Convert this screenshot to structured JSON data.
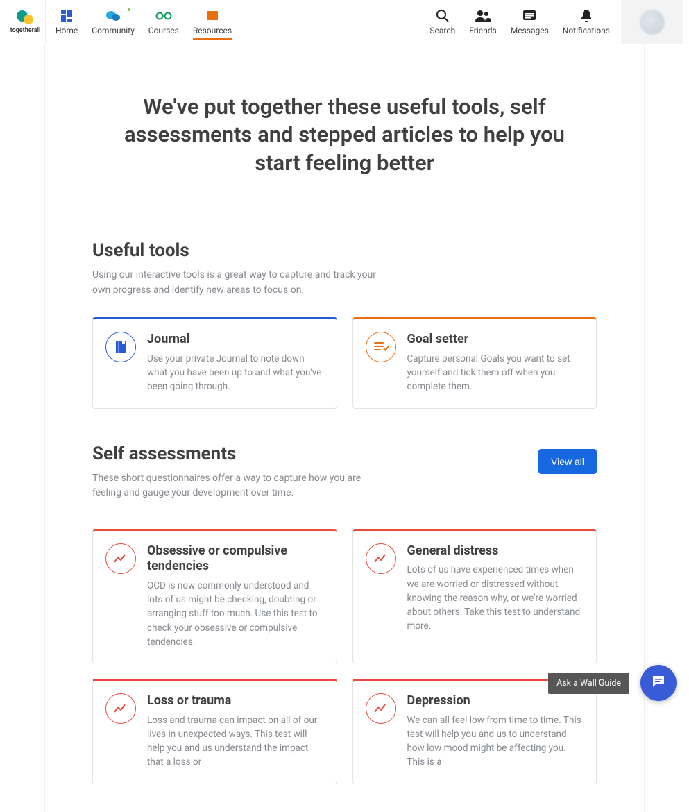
{
  "brand": {
    "name": "togetherall"
  },
  "nav": {
    "left": [
      {
        "label": "Home"
      },
      {
        "label": "Community"
      },
      {
        "label": "Courses"
      },
      {
        "label": "Resources"
      }
    ],
    "right": [
      {
        "label": "Search"
      },
      {
        "label": "Friends"
      },
      {
        "label": "Messages"
      },
      {
        "label": "Notifications"
      }
    ]
  },
  "hero": {
    "title": "We've put together these useful tools, self assessments and stepped articles to help you start feeling better"
  },
  "tools": {
    "heading": "Useful tools",
    "sub": "Using our interactive tools is a great way to capture and track your own progress and identify new areas to focus on.",
    "cards": [
      {
        "title": "Journal",
        "desc": "Use your private Journal to note down what you have been up to and what you've been going through."
      },
      {
        "title": "Goal setter",
        "desc": "Capture personal Goals you want to set yourself and tick them off when you complete them."
      }
    ]
  },
  "assess": {
    "heading": "Self assessments",
    "sub": "These short questionnaires offer a way to capture how you are feeling and gauge your development over time.",
    "viewall": "View all",
    "cards": [
      {
        "title": "Obsessive or compulsive tendencies",
        "desc": "OCD is now commonly understood and lots of us might be checking, doubting or arranging stuff too much. Use this test to check your obsessive or compulsive tendencies."
      },
      {
        "title": "General distress",
        "desc": "Lots of us have experienced times when we are worried or distressed without knowing the reason why, or we're worried about others. Take this test to understand more."
      },
      {
        "title": "Loss or trauma",
        "desc": "Loss and trauma can impact on all of our lives in unexpected ways. This test will help you and us understand the impact that a loss or"
      },
      {
        "title": "Depression",
        "desc": "We can all feel low from time to time. This test will help you and us to understand how low mood might be affecting you. This is a"
      }
    ]
  },
  "wallguide": "Ask a Wall Guide"
}
